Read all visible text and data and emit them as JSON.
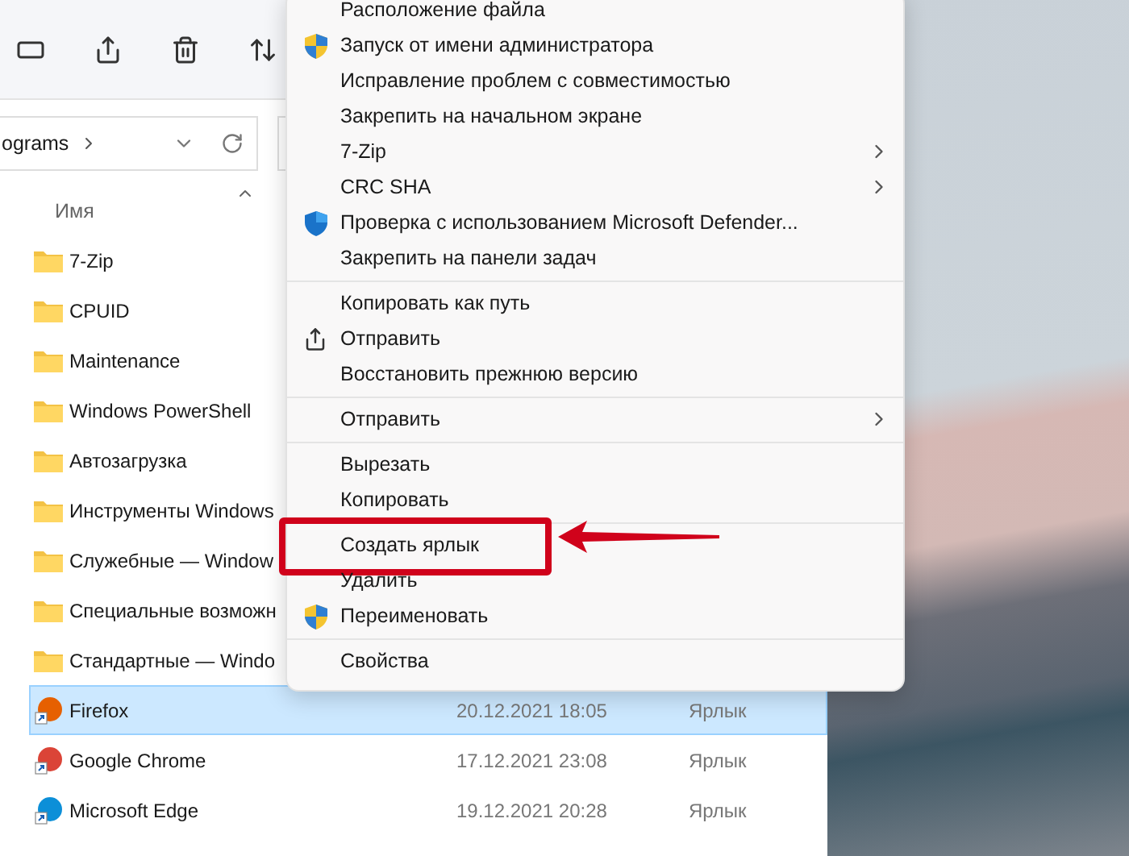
{
  "address_bar": {
    "path": "ograms"
  },
  "file_list": {
    "column_header": "Имя",
    "rows": [
      {
        "kind": "folder",
        "name": "7-Zip",
        "selected": false
      },
      {
        "kind": "folder",
        "name": "CPUID",
        "selected": false
      },
      {
        "kind": "folder",
        "name": "Maintenance",
        "selected": false
      },
      {
        "kind": "folder",
        "name": "Windows PowerShell",
        "selected": false
      },
      {
        "kind": "folder",
        "name": "Автозагрузка",
        "selected": false
      },
      {
        "kind": "folder",
        "name": "Инструменты Windows",
        "selected": false
      },
      {
        "kind": "folder",
        "name": "Служебные — Window",
        "selected": false
      },
      {
        "kind": "folder",
        "name": "Специальные возможн",
        "selected": false
      },
      {
        "kind": "folder",
        "name": "Стандартные — Windo",
        "selected": false
      },
      {
        "kind": "shortcut",
        "name": "Firefox",
        "date": "20.12.2021 18:05",
        "type": "Ярлык",
        "color": "#e66000",
        "selected": true
      },
      {
        "kind": "shortcut",
        "name": "Google Chrome",
        "date": "17.12.2021 23:08",
        "type": "Ярлык",
        "color": "#db4437",
        "selected": false
      },
      {
        "kind": "shortcut",
        "name": "Microsoft Edge",
        "date": "19.12.2021 20:28",
        "type": "Ярлык",
        "color": "#0c8fd8",
        "selected": false
      }
    ]
  },
  "context_menu": {
    "items": [
      {
        "kind": "item",
        "label": "Расположение файла"
      },
      {
        "kind": "shield",
        "label": "Запуск от имени администратора"
      },
      {
        "kind": "item",
        "label": "Исправление проблем с совместимостью"
      },
      {
        "kind": "item",
        "label": "Закрепить на начальном экране"
      },
      {
        "kind": "item",
        "label": "7-Zip",
        "submenu": true
      },
      {
        "kind": "item",
        "label": "CRC SHA",
        "submenu": true
      },
      {
        "kind": "defender",
        "label": "Проверка с использованием Microsoft Defender..."
      },
      {
        "kind": "item",
        "label": "Закрепить на панели задач"
      },
      {
        "kind": "separator"
      },
      {
        "kind": "item",
        "label": "Копировать как путь"
      },
      {
        "kind": "share",
        "label": "Отправить"
      },
      {
        "kind": "item",
        "label": "Восстановить прежнюю версию"
      },
      {
        "kind": "separator"
      },
      {
        "kind": "item",
        "label": "Отправить",
        "submenu": true
      },
      {
        "kind": "separator"
      },
      {
        "kind": "item",
        "label": "Вырезать"
      },
      {
        "kind": "item",
        "label": "Копировать"
      },
      {
        "kind": "separator"
      },
      {
        "kind": "item",
        "label": "Создать ярлык",
        "annotated": true
      },
      {
        "kind": "item",
        "label": "Удалить"
      },
      {
        "kind": "shield",
        "label": "Переименовать"
      },
      {
        "kind": "separator"
      },
      {
        "kind": "item",
        "label": "Свойства"
      }
    ]
  }
}
